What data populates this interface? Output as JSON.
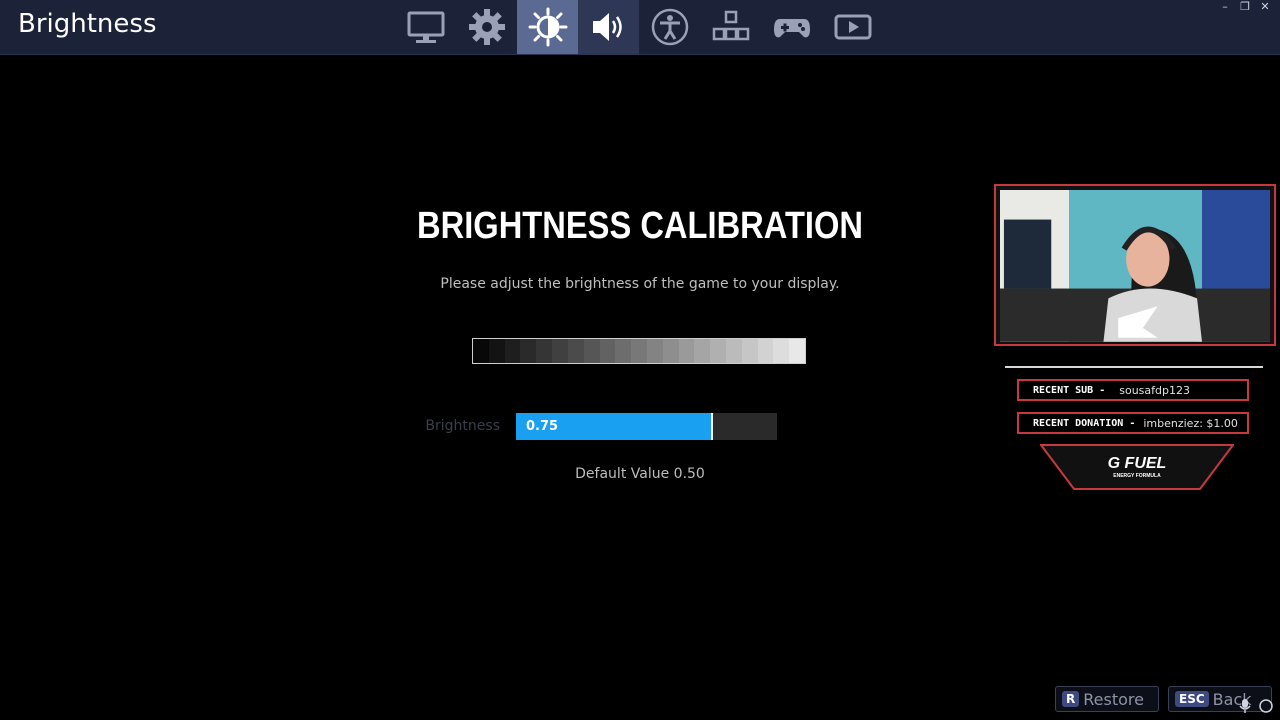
{
  "header": {
    "title": "Brightness",
    "tabs": [
      {
        "icon": "monitor-icon",
        "name": "tab-display"
      },
      {
        "icon": "gear-icon",
        "name": "tab-game"
      },
      {
        "icon": "brightness-icon",
        "name": "tab-brightness",
        "active": true
      },
      {
        "icon": "speaker-icon",
        "name": "tab-audio"
      },
      {
        "icon": "accessibility-icon",
        "name": "tab-accessibility"
      },
      {
        "icon": "input-keys-icon",
        "name": "tab-input"
      },
      {
        "icon": "gamepad-icon",
        "name": "tab-controller"
      },
      {
        "icon": "video-play-icon",
        "name": "tab-replays"
      }
    ]
  },
  "calibration": {
    "title": "BRIGHTNESS CALIBRATION",
    "subtitle": "Please adjust the brightness of the game to your display.",
    "slider_label": "Brightness",
    "slider_value": "0.75",
    "slider_fraction": 0.75,
    "default_value": "Default Value 0.50"
  },
  "overlay": {
    "recent_sub_key": "RECENT SUB -",
    "recent_sub_value": "sousafdp123",
    "recent_donation_key": "RECENT DONATION -",
    "recent_donation_value": "imbenziez: $1.00",
    "sponsor_logo": "G FUEL",
    "sponsor_tagline": "ENERGY FORMULA"
  },
  "footer": {
    "restore_key": "R",
    "restore_label": "Restore",
    "back_key": "ESC",
    "back_label": "Back"
  },
  "colors": {
    "accent_blue": "#1aa0f0",
    "topbar": "#1c2237",
    "active_tab": "#5b6a93",
    "overlay_red": "#c8383f"
  }
}
